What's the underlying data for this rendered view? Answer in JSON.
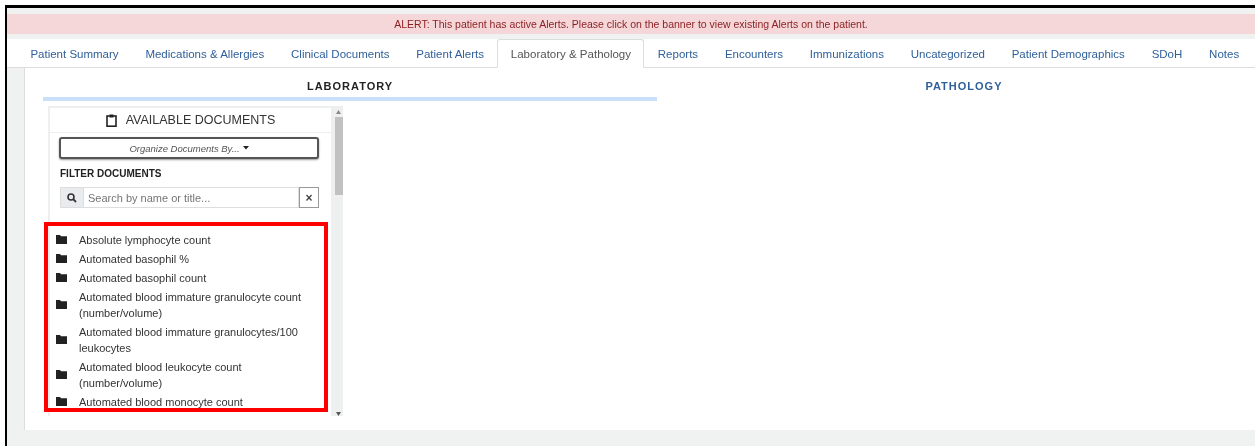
{
  "alert": "ALERT: This patient has active Alerts. Please click on the banner to view existing Alerts on the patient.",
  "tabs": [
    {
      "label": "Patient Summary",
      "selected": false
    },
    {
      "label": "Medications & Allergies",
      "selected": false
    },
    {
      "label": "Clinical Documents",
      "selected": false
    },
    {
      "label": "Patient Alerts",
      "selected": false
    },
    {
      "label": "Laboratory & Pathology",
      "selected": true
    },
    {
      "label": "Reports",
      "selected": false
    },
    {
      "label": "Encounters",
      "selected": false
    },
    {
      "label": "Immunizations",
      "selected": false
    },
    {
      "label": "Uncategorized",
      "selected": false
    },
    {
      "label": "Patient Demographics",
      "selected": false
    },
    {
      "label": "SDoH",
      "selected": false
    },
    {
      "label": "Notes",
      "selected": false
    }
  ],
  "sections": [
    {
      "label": "LABORATORY",
      "selected": true
    },
    {
      "label": "PATHOLOGY",
      "selected": false
    }
  ],
  "panel": {
    "title": "AVAILABLE DOCUMENTS",
    "organize_button": "Organize Documents By...",
    "filter_label": "FILTER DOCUMENTS",
    "search": {
      "placeholder": "Search by name or title..."
    },
    "clear_button": "×",
    "documents": [
      "Absolute lymphocyte count",
      "Automated basophil %",
      "Automated basophil count",
      "Automated blood immature granulocyte count (number/volume)",
      "Automated blood immature granulocytes/100 leukocytes",
      "Automated blood leukocyte count (number/volume)",
      "Automated blood monocyte count"
    ]
  }
}
